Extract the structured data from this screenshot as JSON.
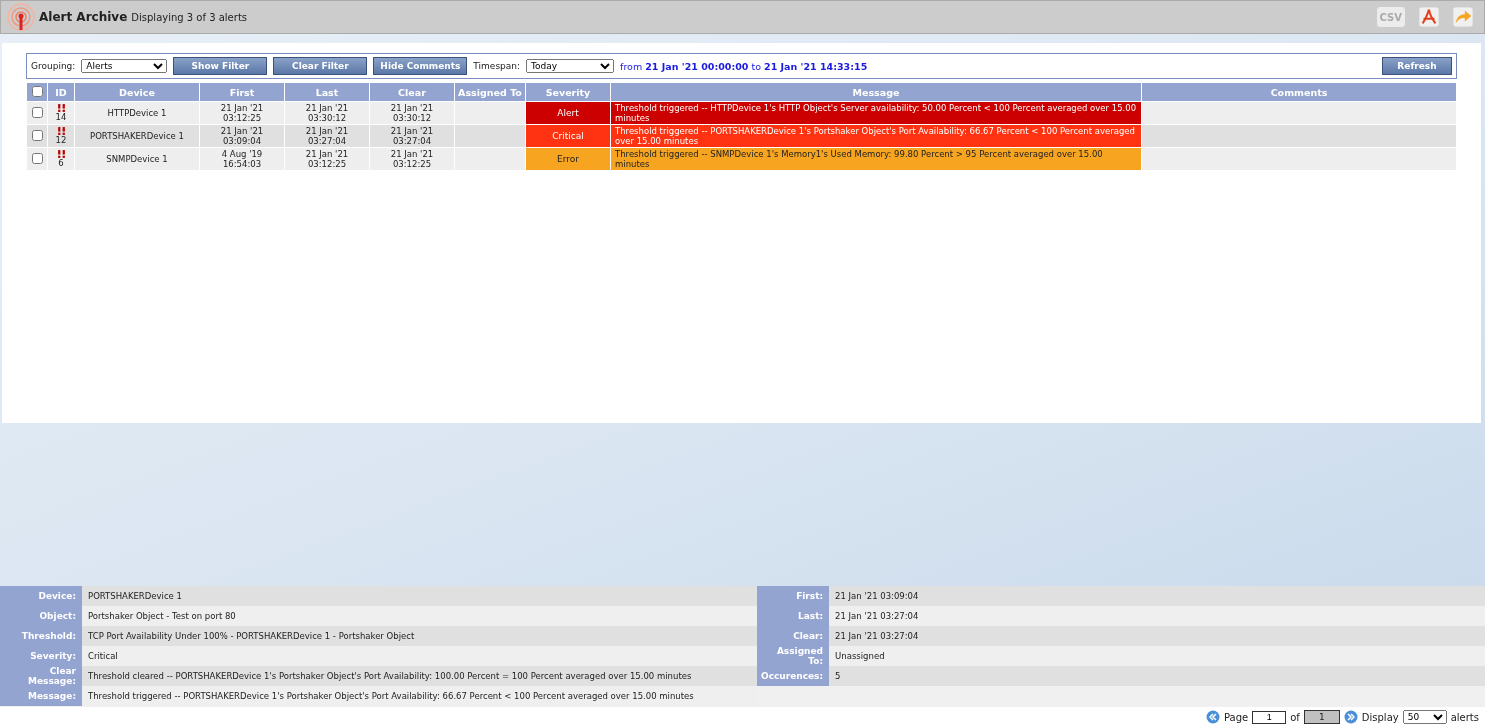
{
  "header": {
    "title": "Alert Archive",
    "subtitle": "Displaying 3 of 3 alerts",
    "csv_button": "CSV"
  },
  "toolbar": {
    "grouping_label": "Grouping:",
    "grouping_value": "Alerts",
    "buttons": [
      "Show Filter",
      "Clear Filter",
      "Hide Comments"
    ],
    "timespan_label": "Timespan:",
    "timespan_value": "Today",
    "range": {
      "from_word": "from",
      "from": "21 Jan '21 00:00:00",
      "to_word": "to",
      "to": "21 Jan '21 14:33:15"
    },
    "refresh": "Refresh"
  },
  "table": {
    "select_all_checked": false,
    "columns": [
      "ID",
      "Device",
      "First",
      "Last",
      "Clear",
      "Assigned To",
      "Severity",
      "Message",
      "Comments"
    ],
    "rows": [
      {
        "checked": false,
        "id": "14",
        "device": "HTTPDevice 1",
        "first": [
          "21 Jan '21",
          "03:12:25"
        ],
        "last": [
          "21 Jan '21",
          "03:30:12"
        ],
        "clear": [
          "21 Jan '21",
          "03:30:12"
        ],
        "severity": "Alert",
        "color": "#cc0000",
        "message": "Threshold triggered -- HTTPDevice 1's HTTP Object's Server availability: 50.00 Percent < 100 Percent averaged over 15.00 minutes"
      },
      {
        "checked": false,
        "id": "12",
        "device": "PORTSHAKERDevice 1",
        "first": [
          "21 Jan '21",
          "03:09:04"
        ],
        "last": [
          "21 Jan '21",
          "03:27:04"
        ],
        "clear": [
          "21 Jan '21",
          "03:27:04"
        ],
        "severity": "Critical",
        "color": "#ff3311",
        "message": "Threshold triggered -- PORTSHAKERDevice 1's Portshaker Object's Port Availability: 66.67 Percent < 100 Percent averaged over 15.00 minutes"
      },
      {
        "checked": false,
        "id": "6",
        "device": "SNMPDevice 1",
        "first": [
          "4 Aug '19",
          "16:54:03"
        ],
        "last": [
          "21 Jan '21",
          "03:12:25"
        ],
        "clear": [
          "21 Jan '21",
          "03:12:25"
        ],
        "severity": "Error",
        "color": "#f7a520",
        "message": "Threshold triggered -- SNMPDevice 1's Memory1's Used Memory: 99.80 Percent > 95 Percent averaged over 15.00 minutes"
      }
    ]
  },
  "details": {
    "left": [
      {
        "label": "Device:",
        "value": "PORTSHAKERDevice 1"
      },
      {
        "label": "Object:",
        "value": "Portshaker Object - Test on port 80"
      },
      {
        "label": "Threshold:",
        "value": "TCP Port Availability Under 100% - PORTSHAKERDevice 1 - Portshaker Object"
      },
      {
        "label": "Severity:",
        "value": "Critical"
      },
      {
        "label": "Clear Message:",
        "value": "Threshold cleared -- PORTSHAKERDevice 1's Portshaker Object's Port Availability: 100.00 Percent = 100 Percent averaged over 15.00 minutes"
      },
      {
        "label": "Message:",
        "value": "Threshold triggered -- PORTSHAKERDevice 1's Portshaker Object's Port Availability: 66.67 Percent < 100 Percent averaged over 15.00 minutes"
      }
    ],
    "right": [
      {
        "label": "First:",
        "value": "21 Jan '21 03:09:04"
      },
      {
        "label": "Last:",
        "value": "21 Jan '21 03:27:04"
      },
      {
        "label": "Clear:",
        "value": "21 Jan '21 03:27:04"
      },
      {
        "label": "Assigned To:",
        "value": "Unassigned"
      },
      {
        "label": "Occurences:",
        "value": "5"
      }
    ]
  },
  "pager": {
    "page_label": "Page",
    "page": "1",
    "of_label": "of",
    "total": "1",
    "display_label": "Display",
    "display_value": "50",
    "alerts_label": "alerts"
  }
}
